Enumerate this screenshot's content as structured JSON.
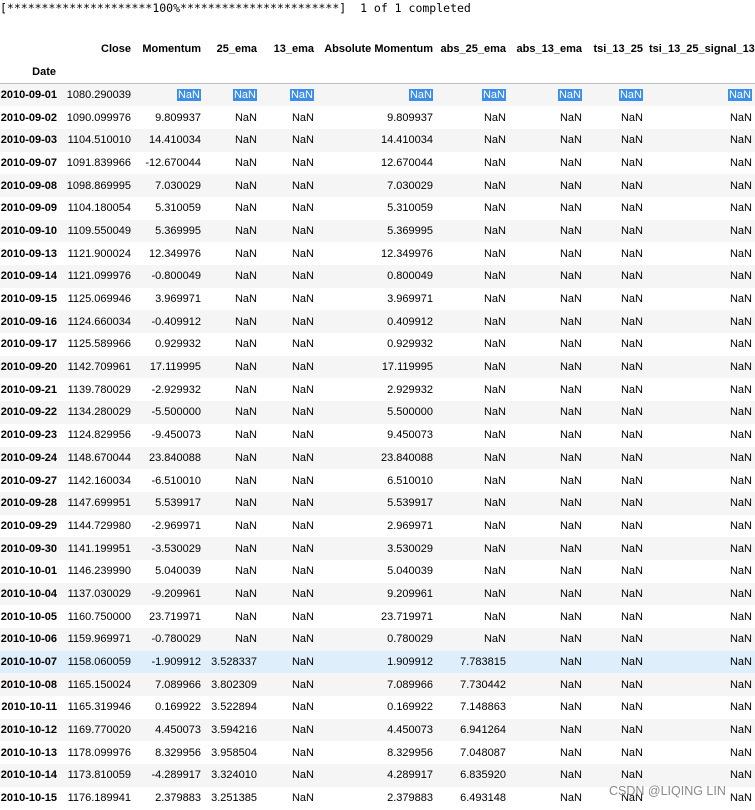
{
  "progress": {
    "bar_left": "[*********************",
    "percent": "100%",
    "bar_right": "***********************]",
    "status": "1 of 1 completed"
  },
  "table": {
    "columns": [
      "Close",
      "Momentum",
      "25_ema",
      "13_ema",
      "Absolute Momentum",
      "abs_25_ema",
      "abs_13_ema",
      "tsi_13_25",
      "tsi_13_25_signal_13"
    ],
    "index_name": "Date",
    "highlighted_row_index": 25,
    "selected_row_index": 0,
    "rows": [
      [
        "2010-09-01",
        "1080.290039",
        "NaN",
        "NaN",
        "NaN",
        "NaN",
        "NaN",
        "NaN",
        "NaN",
        "NaN"
      ],
      [
        "2010-09-02",
        "1090.099976",
        "9.809937",
        "NaN",
        "NaN",
        "9.809937",
        "NaN",
        "NaN",
        "NaN",
        "NaN"
      ],
      [
        "2010-09-03",
        "1104.510010",
        "14.410034",
        "NaN",
        "NaN",
        "14.410034",
        "NaN",
        "NaN",
        "NaN",
        "NaN"
      ],
      [
        "2010-09-07",
        "1091.839966",
        "-12.670044",
        "NaN",
        "NaN",
        "12.670044",
        "NaN",
        "NaN",
        "NaN",
        "NaN"
      ],
      [
        "2010-09-08",
        "1098.869995",
        "7.030029",
        "NaN",
        "NaN",
        "7.030029",
        "NaN",
        "NaN",
        "NaN",
        "NaN"
      ],
      [
        "2010-09-09",
        "1104.180054",
        "5.310059",
        "NaN",
        "NaN",
        "5.310059",
        "NaN",
        "NaN",
        "NaN",
        "NaN"
      ],
      [
        "2010-09-10",
        "1109.550049",
        "5.369995",
        "NaN",
        "NaN",
        "5.369995",
        "NaN",
        "NaN",
        "NaN",
        "NaN"
      ],
      [
        "2010-09-13",
        "1121.900024",
        "12.349976",
        "NaN",
        "NaN",
        "12.349976",
        "NaN",
        "NaN",
        "NaN",
        "NaN"
      ],
      [
        "2010-09-14",
        "1121.099976",
        "-0.800049",
        "NaN",
        "NaN",
        "0.800049",
        "NaN",
        "NaN",
        "NaN",
        "NaN"
      ],
      [
        "2010-09-15",
        "1125.069946",
        "3.969971",
        "NaN",
        "NaN",
        "3.969971",
        "NaN",
        "NaN",
        "NaN",
        "NaN"
      ],
      [
        "2010-09-16",
        "1124.660034",
        "-0.409912",
        "NaN",
        "NaN",
        "0.409912",
        "NaN",
        "NaN",
        "NaN",
        "NaN"
      ],
      [
        "2010-09-17",
        "1125.589966",
        "0.929932",
        "NaN",
        "NaN",
        "0.929932",
        "NaN",
        "NaN",
        "NaN",
        "NaN"
      ],
      [
        "2010-09-20",
        "1142.709961",
        "17.119995",
        "NaN",
        "NaN",
        "17.119995",
        "NaN",
        "NaN",
        "NaN",
        "NaN"
      ],
      [
        "2010-09-21",
        "1139.780029",
        "-2.929932",
        "NaN",
        "NaN",
        "2.929932",
        "NaN",
        "NaN",
        "NaN",
        "NaN"
      ],
      [
        "2010-09-22",
        "1134.280029",
        "-5.500000",
        "NaN",
        "NaN",
        "5.500000",
        "NaN",
        "NaN",
        "NaN",
        "NaN"
      ],
      [
        "2010-09-23",
        "1124.829956",
        "-9.450073",
        "NaN",
        "NaN",
        "9.450073",
        "NaN",
        "NaN",
        "NaN",
        "NaN"
      ],
      [
        "2010-09-24",
        "1148.670044",
        "23.840088",
        "NaN",
        "NaN",
        "23.840088",
        "NaN",
        "NaN",
        "NaN",
        "NaN"
      ],
      [
        "2010-09-27",
        "1142.160034",
        "-6.510010",
        "NaN",
        "NaN",
        "6.510010",
        "NaN",
        "NaN",
        "NaN",
        "NaN"
      ],
      [
        "2010-09-28",
        "1147.699951",
        "5.539917",
        "NaN",
        "NaN",
        "5.539917",
        "NaN",
        "NaN",
        "NaN",
        "NaN"
      ],
      [
        "2010-09-29",
        "1144.729980",
        "-2.969971",
        "NaN",
        "NaN",
        "2.969971",
        "NaN",
        "NaN",
        "NaN",
        "NaN"
      ],
      [
        "2010-09-30",
        "1141.199951",
        "-3.530029",
        "NaN",
        "NaN",
        "3.530029",
        "NaN",
        "NaN",
        "NaN",
        "NaN"
      ],
      [
        "2010-10-01",
        "1146.239990",
        "5.040039",
        "NaN",
        "NaN",
        "5.040039",
        "NaN",
        "NaN",
        "NaN",
        "NaN"
      ],
      [
        "2010-10-04",
        "1137.030029",
        "-9.209961",
        "NaN",
        "NaN",
        "9.209961",
        "NaN",
        "NaN",
        "NaN",
        "NaN"
      ],
      [
        "2010-10-05",
        "1160.750000",
        "23.719971",
        "NaN",
        "NaN",
        "23.719971",
        "NaN",
        "NaN",
        "NaN",
        "NaN"
      ],
      [
        "2010-10-06",
        "1159.969971",
        "-0.780029",
        "NaN",
        "NaN",
        "0.780029",
        "NaN",
        "NaN",
        "NaN",
        "NaN"
      ],
      [
        "2010-10-07",
        "1158.060059",
        "-1.909912",
        "3.528337",
        "NaN",
        "1.909912",
        "7.783815",
        "NaN",
        "NaN",
        "NaN"
      ],
      [
        "2010-10-08",
        "1165.150024",
        "7.089966",
        "3.802309",
        "NaN",
        "7.089966",
        "7.730442",
        "NaN",
        "NaN",
        "NaN"
      ],
      [
        "2010-10-11",
        "1165.319946",
        "0.169922",
        "3.522894",
        "NaN",
        "0.169922",
        "7.148863",
        "NaN",
        "NaN",
        "NaN"
      ],
      [
        "2010-10-12",
        "1169.770020",
        "4.450073",
        "3.594216",
        "NaN",
        "4.450073",
        "6.941264",
        "NaN",
        "NaN",
        "NaN"
      ],
      [
        "2010-10-13",
        "1178.099976",
        "8.329956",
        "3.958504",
        "NaN",
        "8.329956",
        "7.048087",
        "NaN",
        "NaN",
        "NaN"
      ],
      [
        "2010-10-14",
        "1173.810059",
        "-4.289917",
        "3.324010",
        "NaN",
        "4.289917",
        "6.835920",
        "NaN",
        "NaN",
        "NaN"
      ],
      [
        "2010-10-15",
        "1176.189941",
        "2.379883",
        "3.251385",
        "NaN",
        "2.379883",
        "6.493148",
        "NaN",
        "NaN",
        "NaN"
      ]
    ]
  },
  "watermark": "CSDN @LIQING LIN"
}
